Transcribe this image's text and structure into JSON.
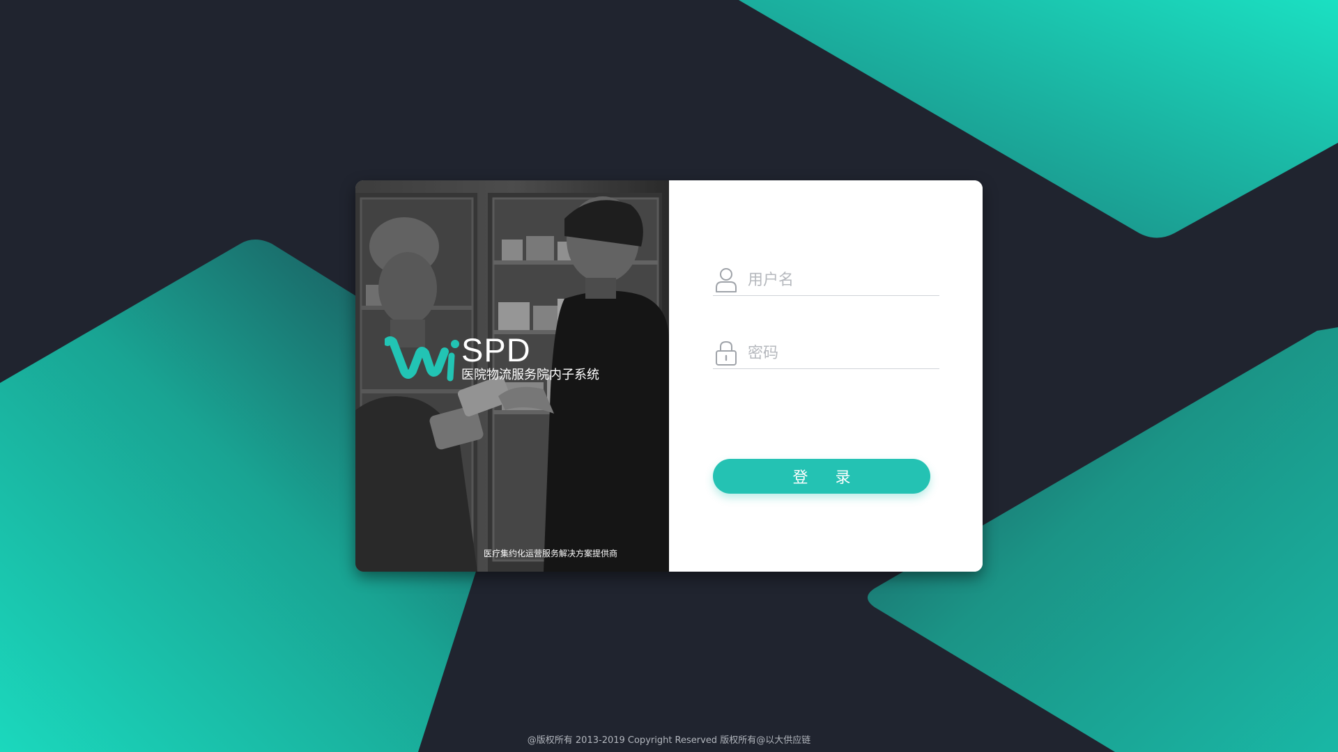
{
  "brand": {
    "logo_name": "SPD",
    "logo_subtitle": "医院物流服务院内子系统",
    "tagline": "医疗集约化运营服务解决方案提供商",
    "accent_color": "#24c2b3",
    "background_color": "#20242f"
  },
  "login_form": {
    "username_placeholder": "用户名",
    "username_value": "",
    "username_icon": "user-icon",
    "password_placeholder": "密码",
    "password_value": "",
    "password_icon": "lock-icon",
    "submit_label": "登 录"
  },
  "footer": {
    "copyright": "@版权所有 2013-2019 Copyright Reserved 版权所有@以大供应链"
  }
}
